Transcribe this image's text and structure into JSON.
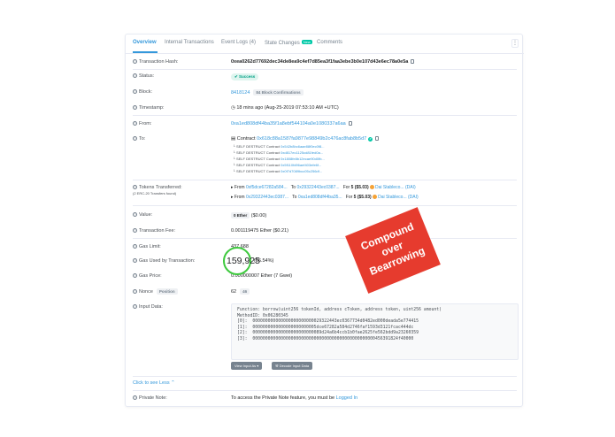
{
  "tabs": [
    {
      "label": "Overview"
    },
    {
      "label": "Internal Transactions"
    },
    {
      "label": "Event Logs (4)"
    },
    {
      "label": "State Changes"
    },
    {
      "label": "Comments"
    }
  ],
  "state_changes_badge": "New",
  "more_button": "⋮",
  "tx_hash": {
    "label": "Transaction Hash:",
    "value": "0xea0262d77692dec34de8ea9c4ef7d85ea3f1faa3ebe3b0e107d43e6ec78a0e5a"
  },
  "status": {
    "label": "Status:",
    "value": "Success"
  },
  "block": {
    "label": "Block:",
    "number": "8418124",
    "confirmations": "84 Block Confirmations"
  },
  "timestamp": {
    "label": "Timestamp:",
    "value": "18 mins ago (Aug-25-2019 07:53:10 AM +UTC)"
  },
  "from": {
    "label": "From:",
    "value": "0xa1ed808df44ba35f1a8ebf544104a0e1080337a6aa"
  },
  "to": {
    "label": "To:",
    "prefix": "Contract",
    "contract": "0x618c88a1587fa9877e98849b2c476ac8fab8b5d7",
    "self_destructs": [
      {
        "prefix": "SELF DESTRUCT",
        "kind": "Contract",
        "addr": "0x542b8bc6aae88f0ec0f8..."
      },
      {
        "prefix": "SELF DESTRUCT",
        "kind": "Contract",
        "addr": "0xd817ec1125cd81fed0a..."
      },
      {
        "prefix": "SELF DESTRUCT",
        "kind": "Contract",
        "addr": "0x1808fe8b12ecae90d0fb..."
      },
      {
        "prefix": "SELF DESTRUCT",
        "kind": "Contract",
        "addr": "0x5f110fd96aef403efe6f..."
      },
      {
        "prefix": "SELF DESTRUCT",
        "kind": "Contract",
        "addr": "0x0f7d7089bcc05c256df..."
      }
    ]
  },
  "tokens": {
    "label": "Tokens Transferred:",
    "sublabel": "(2 ERC-20 Transfers found)",
    "transfers": [
      {
        "from_label": "From",
        "from": "0xf5dce67282a584...",
        "to_label": "To",
        "to": "0x29322443ec0387...",
        "for_label": "For",
        "amount": "5 ($5.03)",
        "token": "Dai Stableco...",
        "symbol": "(DAI)"
      },
      {
        "from_label": "From",
        "from": "0x29322443ec0387...",
        "to_label": "To",
        "to": "0xa1ed808df44ba35...",
        "for_label": "For",
        "amount": "5 ($5.03)",
        "token": "Dai Stableco...",
        "symbol": "(DAI)"
      }
    ]
  },
  "value": {
    "label": "Value:",
    "ether": "0 Ether",
    "usd": "($0.00)"
  },
  "fee": {
    "label": "Transaction Fee:",
    "value": "0.001119475 Ether ($0.21)"
  },
  "gas_limit": {
    "label": "Gas Limit:",
    "value": "437,688"
  },
  "gas_used": {
    "label": "Gas Used by Transaction:",
    "value": "159,925",
    "pct": "(36.54%)"
  },
  "gas_price": {
    "label": "Gas Price:",
    "value": "0.000000007 Ether (7 Gwei)"
  },
  "nonce": {
    "label": "Nonce",
    "position_label": "Position",
    "value": "62",
    "position": "46"
  },
  "input": {
    "label": "Input Data:",
    "lines": [
      "Function: borrow(uint256 tokenId, address cToken, address token, uint256 amount)",
      "",
      "MethodID: 0x06280345",
      "[0]:  000000000000000000000000029322443ec0367734d0482ed000deada5e774415",
      "[1]:  0000000000000000000000005dce67282a584d2746faf1593d3121fcac444dc",
      "[2]:  000000000000000000000000089d24a6b4ccb1b0fae2625fe562bdd9a23260359",
      "[3]:  000000000000000000000000000000000000000000000000456391824f40000"
    ],
    "view_button": "View Input As",
    "decode_button": "Decode Input Data"
  },
  "see_less": "Click to see Less",
  "private_note": {
    "label": "Private Note:",
    "text": "To access the Private Note feature, you must be",
    "link": "Logged In"
  },
  "sticker": {
    "line1": "Compound",
    "line2": "over",
    "line3": "Bearrowing"
  },
  "colors": {
    "accent": "#3498db",
    "success": "#00c9a7",
    "sticker": "#e63b2e",
    "highlight_circle": "#3ec93e"
  }
}
